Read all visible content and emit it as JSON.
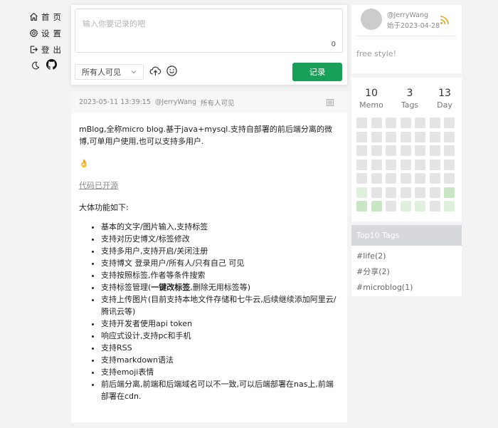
{
  "nav": {
    "items": [
      {
        "label": "首页",
        "icon": "home-icon"
      },
      {
        "label": "设置",
        "icon": "gear-icon"
      },
      {
        "label": "登出",
        "icon": "logout-icon"
      }
    ],
    "icons": [
      "moon-icon",
      "github-icon"
    ]
  },
  "editor": {
    "placeholder": "输入你要记录的吧",
    "char_count": "0",
    "visibility": "所有人可见",
    "submit_label": "记录",
    "accent": "#18a058"
  },
  "post": {
    "time": "2023-05-11 13:39:15",
    "author": "@JerryWang",
    "visibility": "所有人可见",
    "intro": "mBlog,全称micro blog.基于java+mysql.支持自部署的前后端分离的微博,可单用户使用,也可以支持多用户.",
    "emoji": "👌",
    "link": "代码已开源",
    "features_title": "大体功能如下:",
    "features": [
      "基本的文字/图片输入,支持标签",
      "支持对历史博文/标签修改",
      "支持多用户,支持开启/关闭注册",
      "支持博文 登录用户/所有人/只有自己 可见",
      "支持按照标签,作者等条件搜索",
      {
        "pre": "支持标签管理(",
        "bold": "一键改标签",
        "post": ",删除无用标签等)"
      },
      "支持上传图片(目前支持本地文件存储和七牛云,后续继续添加阿里云/腾讯云等)",
      "支持开发者使用api token",
      "响应式设计,支持pc和手机",
      "支持RSS",
      "支持markdown语法",
      "支持emoji表情",
      "前后端分离,前端和后端域名可以不一致,可以后端部署在nas上,前端部署在cdn."
    ]
  },
  "profile": {
    "username": "@JerryWang",
    "since": "始于2023-04-28",
    "motto": "free style!",
    "rss_color": "#e5a50a"
  },
  "stats": {
    "memo": {
      "value": "10",
      "label": "Memo"
    },
    "tags": {
      "value": "3",
      "label": "Tags"
    },
    "days": {
      "value": "13",
      "label": "Day"
    },
    "heatmap_levels": [
      0,
      0,
      0,
      0,
      0,
      0,
      0,
      0,
      0,
      0,
      0,
      0,
      0,
      0,
      0,
      0,
      0,
      0,
      0,
      0,
      0,
      0,
      0,
      0,
      0,
      0,
      0,
      0,
      0,
      0,
      0,
      0,
      0,
      0,
      0,
      1,
      0,
      0,
      0,
      0,
      0,
      2,
      2,
      2,
      0,
      1,
      1,
      0,
      1
    ]
  },
  "top_tags": {
    "title": "Top10 Tags",
    "items": [
      "#life(2)",
      "#分享(2)",
      "#microblog(1)"
    ]
  }
}
